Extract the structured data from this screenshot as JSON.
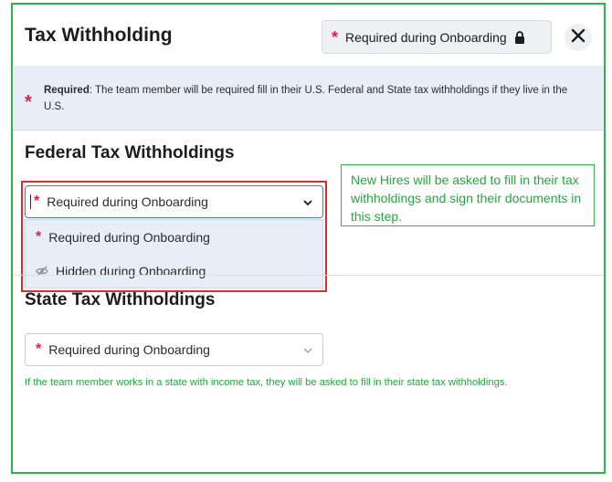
{
  "modal": {
    "title": "Tax Withholding",
    "status_pill": {
      "label": "Required during Onboarding",
      "icon": "lock-icon"
    },
    "close_icon": "close-icon"
  },
  "banner": {
    "bold": "Required",
    "text": ": The team member will be required fill in their U.S. Federal and State tax withholdings if they live in the U.S."
  },
  "federal": {
    "title": "Federal Tax Withholdings",
    "select_value": "Required during Onboarding",
    "options": [
      {
        "label": "Required during Onboarding",
        "icon": "asterisk-icon"
      },
      {
        "label": "Hidden during Onboarding",
        "icon": "eye-slash-icon"
      }
    ]
  },
  "state": {
    "title": "State Tax Withholdings",
    "select_value": "Required during Onboarding",
    "note": "If the team member works in a state with income tax, they will be asked to fill in their state tax withholdings."
  },
  "callout": {
    "text": "New Hires will be asked to fill in their tax withholdings and sign their documents in this step."
  },
  "colors": {
    "required_asterisk": "#e11d48",
    "annotation_green": "#22a83d",
    "highlight_red": "#e12b2b",
    "banner_bg": "#e8eef8"
  }
}
